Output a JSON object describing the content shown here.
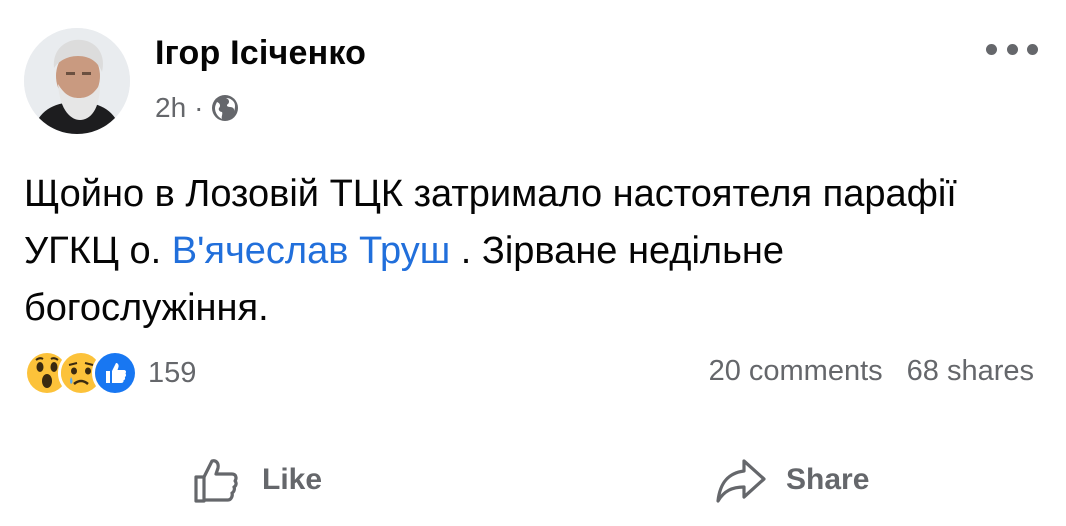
{
  "post": {
    "author": "Ігор Ісіченко",
    "time": "2h",
    "separator": "·",
    "visibility_icon": "globe-icon",
    "more_icon": "more-options-icon",
    "text_before": "Щойно в Лозовій ТЦК затримало настоятеля парафії УГКЦ о. ",
    "mention": "В'ячеслав Труш",
    "text_after": " . Зірване недільне богослужіння."
  },
  "reactions": {
    "icons": [
      "wow-emoji-icon",
      "sad-emoji-icon",
      "like-reaction-icon"
    ],
    "count": "159",
    "comments": "20 comments",
    "shares": "68 shares"
  },
  "actions": {
    "like_label": "Like",
    "share_label": "Share"
  },
  "colors": {
    "mention": "#216fdb",
    "secondary_text": "#65676b",
    "like_blue": "#1877f2",
    "emoji_yellow": "#fcc23a"
  }
}
